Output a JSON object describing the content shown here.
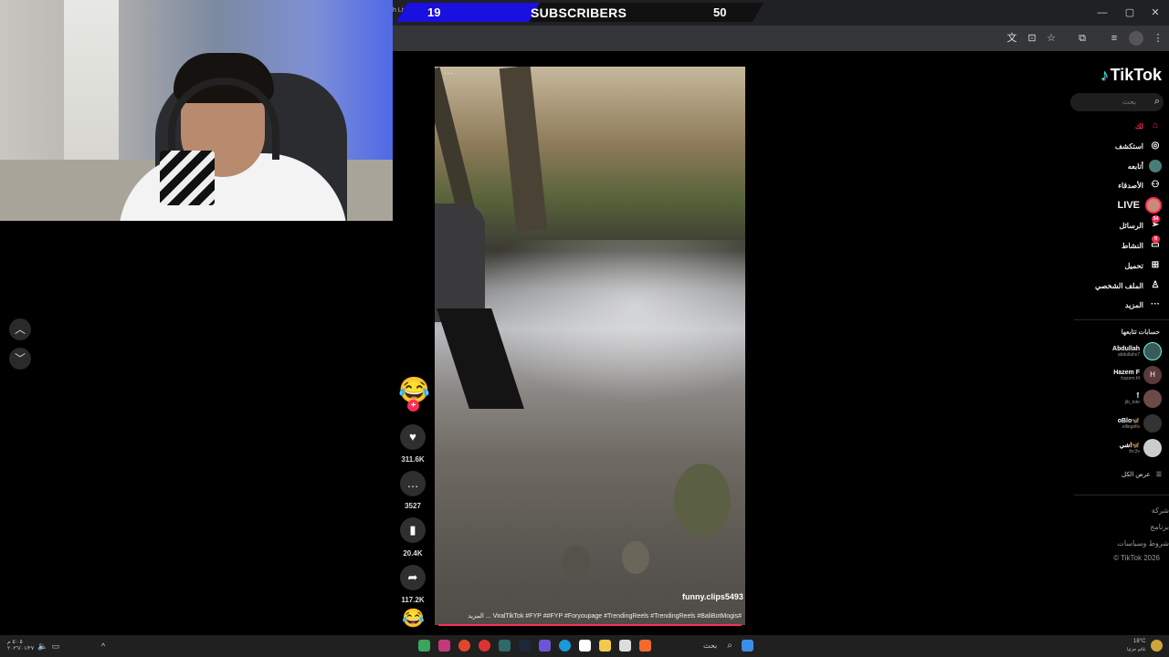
{
  "browser": {
    "tab_text": "h Live",
    "banner": {
      "left_count": "19",
      "title": "SUBSCRIBERS",
      "right_count": "50"
    },
    "window_controls": [
      "—",
      "▢",
      "✕"
    ]
  },
  "video": {
    "top_dots": "···",
    "handle": "funny.clips5493",
    "caption": "#ViralTikTok #FYP ##FYP #Foryoupage #TrendingReels #TrendingReels #BaliBotMogis ... المزيد"
  },
  "actions": {
    "likes": "311.6K",
    "comments": "3527",
    "saves": "20.4K",
    "shares": "117.2K"
  },
  "sidebar": {
    "logo": "TikTok",
    "search_placeholder": "بحث",
    "items": [
      {
        "label": "لك"
      },
      {
        "label": "استكشف"
      },
      {
        "label": "أتابعه"
      },
      {
        "label": "الأصدقاء"
      },
      {
        "label": "LIVE"
      },
      {
        "label": "الرسائل",
        "badge": "54"
      },
      {
        "label": "النشاط",
        "badge": "9"
      },
      {
        "label": "تحميل"
      },
      {
        "label": "الملف الشخصي"
      },
      {
        "label": "المزيد"
      }
    ],
    "following_title": "حسابات تتابعها",
    "following": [
      {
        "name": "Abdullah",
        "handle": "abdullahx7",
        "initial": ""
      },
      {
        "name": "Hazem F",
        "handle": "hazem.f4",
        "initial": "H"
      },
      {
        "name": "ٱ",
        "handle": "jib_tote",
        "initial": ""
      },
      {
        "name": "oBlo🦋",
        "handle": "elliegirlls",
        "initial": ""
      },
      {
        "name": "اشي🦋",
        "handle": "ihc3v",
        "initial": ""
      }
    ],
    "see_all": "عرض الكل",
    "footer": [
      "شركة",
      "برنامج",
      "شروط وسياسات",
      "© TikTok 2026"
    ]
  },
  "taskbar": {
    "left_date": "٥:٠٥ م\n٢٠٢٦/٠١/٢٧",
    "search_label": "بحث",
    "weather": "18°C",
    "weather_sub": "غائم جزئيا"
  },
  "colors": {
    "accent": "#fe2c55",
    "banner_blue": "#1a10e0",
    "cyan": "#25f4ee"
  }
}
